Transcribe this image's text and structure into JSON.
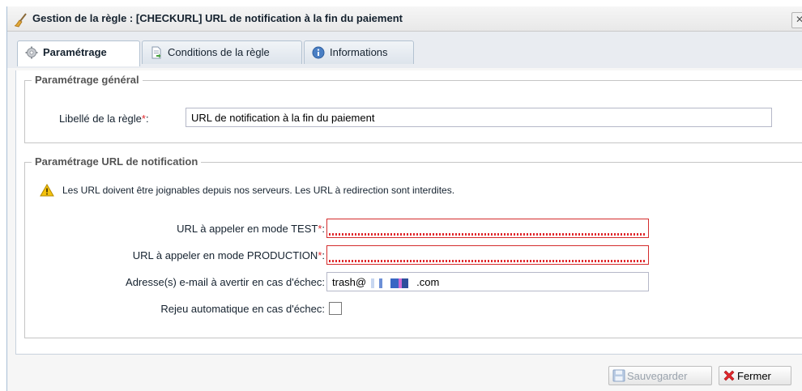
{
  "window": {
    "title": "Gestion de la règle : [CHECKURL] URL de notification à la fin du paiement",
    "close_label": "✕"
  },
  "tabs": [
    {
      "label": "Paramétrage",
      "icon": "gear-icon",
      "active": true
    },
    {
      "label": "Conditions de la règle",
      "icon": "document-icon",
      "active": false
    },
    {
      "label": "Informations",
      "icon": "info-icon",
      "active": false
    }
  ],
  "general": {
    "legend": "Paramétrage général",
    "rule_label": {
      "label": "Libellé de la règle",
      "required": "*",
      "colon": ":",
      "value": "URL de notification à la fin du paiement"
    }
  },
  "notification": {
    "legend": "Paramétrage URL de notification",
    "warning": "Les URL doivent être joignables depuis nos serveurs. Les URL à redirection sont interdites.",
    "url_test": {
      "label": "URL à appeler en mode TEST",
      "required": "*",
      "colon": ":",
      "value": ""
    },
    "url_prod": {
      "label": "URL à appeler en mode PRODUCTION",
      "required": "*",
      "colon": ":",
      "value": ""
    },
    "email": {
      "label": "Adresse(s) e-mail à avertir en cas d'échec:",
      "value_prefix": "trash@",
      "value_suffix": ".com"
    },
    "retry": {
      "label": "Rejeu automatique en cas d'échec:",
      "checked": false
    }
  },
  "footer": {
    "save_label": "Sauvegarder",
    "close_label": "Fermer"
  },
  "colors": {
    "required": "#e0262b",
    "invalid_border": "#d42c2c",
    "warning": "#f4c20d",
    "close_x": "#e0262b"
  }
}
